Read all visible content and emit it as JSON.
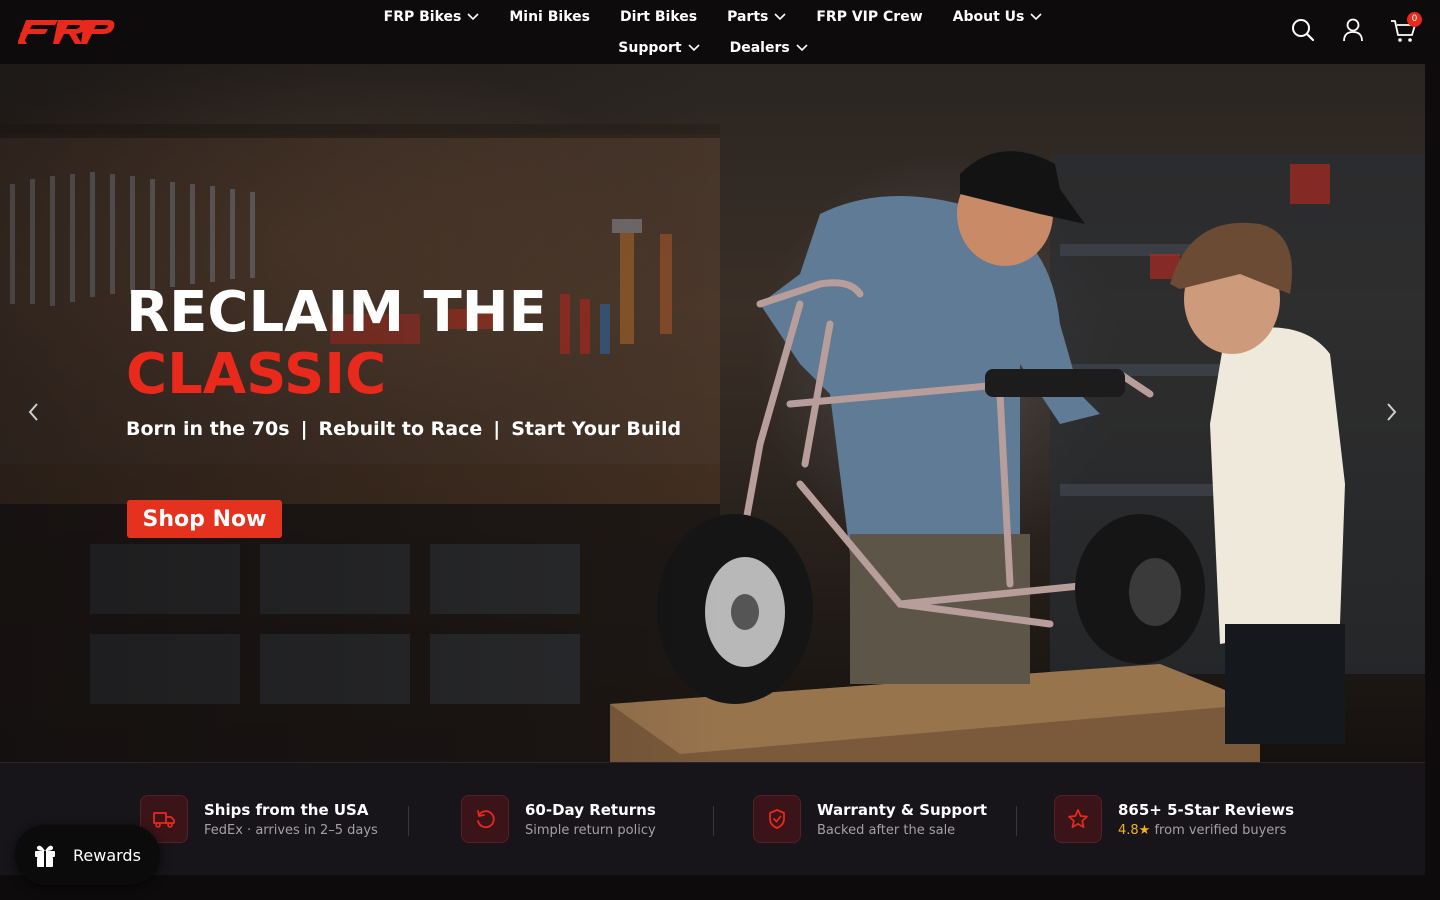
{
  "brand": {
    "logo_text": "FRP",
    "accent": "#e8291c"
  },
  "nav": {
    "items": [
      {
        "label": "FRP Bikes",
        "dropdown": true
      },
      {
        "label": "Mini Bikes",
        "dropdown": false
      },
      {
        "label": "Dirt Bikes",
        "dropdown": false
      },
      {
        "label": "Parts",
        "dropdown": true
      },
      {
        "label": "FRP VIP Crew",
        "dropdown": false
      },
      {
        "label": "About Us",
        "dropdown": true
      },
      {
        "label": "Support",
        "dropdown": true
      },
      {
        "label": "Dealers",
        "dropdown": true
      }
    ]
  },
  "header_icons": {
    "search": "search-icon",
    "account": "user-icon",
    "cart": "cart-icon",
    "cart_count": "0"
  },
  "hero": {
    "title_line1": "RECLAIM THE",
    "title_line2": "CLASSIC",
    "subtitle_parts": [
      "Born in the 70s",
      "|",
      "Rebuilt to Race",
      "|",
      "Start Your Build"
    ],
    "cta_label": "Shop Now",
    "prev_icon": "chevron-left-icon",
    "next_icon": "chevron-right-icon"
  },
  "features": [
    {
      "icon": "truck-icon",
      "title": "Ships from the USA",
      "subtitle": "FedEx · arrives in 2–5 days"
    },
    {
      "icon": "refresh-icon",
      "title": "60-Day Returns",
      "subtitle": "Simple return policy"
    },
    {
      "icon": "shield-check-icon",
      "title": "Warranty & Support",
      "subtitle": "Backed after the sale"
    },
    {
      "icon": "star-icon",
      "title": "865+ 5-Star Reviews",
      "rating": "4.8★",
      "subtitle_rest": " from verified buyers"
    }
  ],
  "rewards": {
    "label": "Rewards",
    "icon": "gift-icon"
  }
}
